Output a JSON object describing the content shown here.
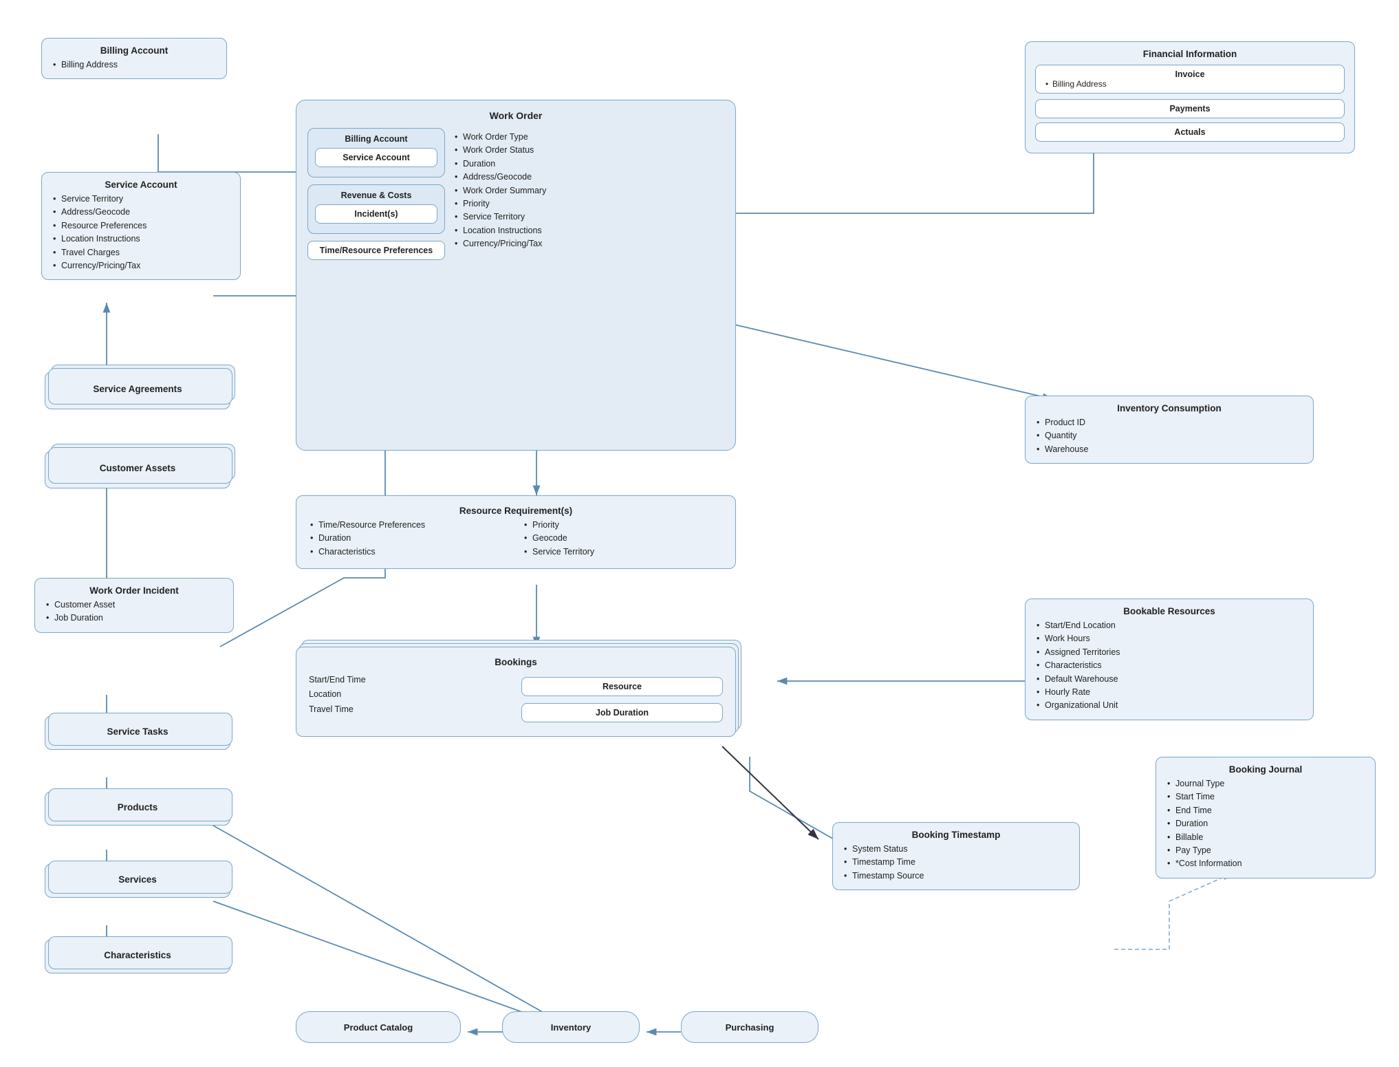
{
  "billing_account_top": {
    "title": "Billing Account",
    "items": [
      "Billing Address"
    ]
  },
  "service_account": {
    "title": "Service Account",
    "items": [
      "Service Territory",
      "Address/Geocode",
      "Resource Preferences",
      "Location Instructions",
      "Travel Charges",
      "Currency/Pricing/Tax"
    ]
  },
  "service_agreements": {
    "label": "Service Agreements"
  },
  "customer_assets": {
    "label": "Customer Assets"
  },
  "work_order_incident": {
    "title": "Work Order Incident",
    "items": [
      "Customer Asset",
      "Job Duration"
    ]
  },
  "service_tasks": {
    "label": "Service Tasks"
  },
  "products": {
    "label": "Products"
  },
  "services": {
    "label": "Services"
  },
  "characteristics_left": {
    "label": "Characteristics"
  },
  "product_catalog": {
    "label": "Product Catalog"
  },
  "inventory": {
    "label": "Inventory"
  },
  "purchasing": {
    "label": "Purchasing"
  },
  "work_order": {
    "title": "Work Order",
    "billing_account_inner": "Billing Account",
    "service_account_inner": "Service Account",
    "revenue_costs": "Revenue & Costs",
    "incidents_inner": "Incident(s)",
    "time_resource": "Time/Resource Preferences",
    "items": [
      "Work Order Type",
      "Work Order Status",
      "Duration",
      "Address/Geocode",
      "Work Order Summary",
      "Priority",
      "Service Territory",
      "Location Instructions",
      "Currency/Pricing/Tax"
    ]
  },
  "resource_requirements": {
    "title": "Resource Requirement(s)",
    "items_left": [
      "Time/Resource Preferences",
      "Duration",
      "Characteristics"
    ],
    "items_right": [
      "Priority",
      "Geocode",
      "Service Territory"
    ]
  },
  "bookings": {
    "title": "Bookings",
    "left_items": [
      "Start/End Time",
      "Location",
      "Travel Time"
    ],
    "resource_inner": "Resource",
    "job_duration_inner": "Job Duration"
  },
  "financial_information": {
    "title": "Financial Information",
    "invoice_inner": "Invoice",
    "invoice_item": "Billing Address",
    "payments_inner": "Payments",
    "actuals_inner": "Actuals"
  },
  "inventory_consumption": {
    "title": "Inventory Consumption",
    "items": [
      "Product ID",
      "Quantity",
      "Warehouse"
    ]
  },
  "bookable_resources": {
    "title": "Bookable Resources",
    "items": [
      "Start/End Location",
      "Work Hours",
      "Assigned Territories",
      "Characteristics",
      "Default Warehouse",
      "Hourly Rate",
      "Organizational Unit"
    ]
  },
  "booking_timestamp": {
    "title": "Booking Timestamp",
    "items": [
      "System Status",
      "Timestamp Time",
      "Timestamp Source"
    ]
  },
  "booking_journal": {
    "title": "Booking Journal",
    "items": [
      "Journal Type",
      "Start Time",
      "End Time",
      "Duration",
      "Billable",
      "Pay Type",
      "*Cost Information"
    ]
  }
}
